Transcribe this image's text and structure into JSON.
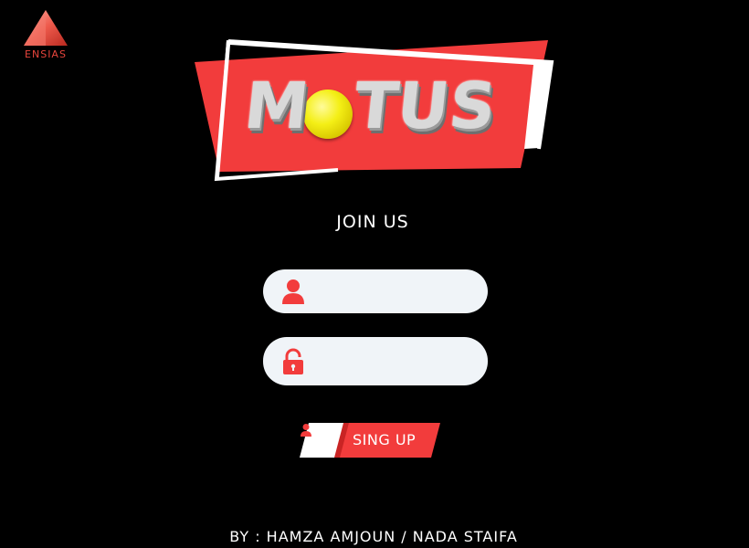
{
  "logo": {
    "text": "ENSIAS",
    "color": "#e8453c"
  },
  "banner": {
    "title_letters": [
      "M",
      "T",
      "U",
      "S"
    ],
    "ball_color": "#f4ef16",
    "banner_color": "#f23c3c",
    "frame_color": "#ffffff"
  },
  "form": {
    "title": "JOIN US",
    "username": {
      "value": "",
      "placeholder": "",
      "icon": "user-icon"
    },
    "password": {
      "value": "",
      "placeholder": "",
      "icon": "lock-icon"
    },
    "submit_label": "SING UP",
    "submit_icon": "user-icon",
    "accent": "#f23c3c",
    "field_bg": "#f0f4f8"
  },
  "footer": {
    "credits": "BY : HAMZA AMJOUN / NADA STAIFA"
  }
}
